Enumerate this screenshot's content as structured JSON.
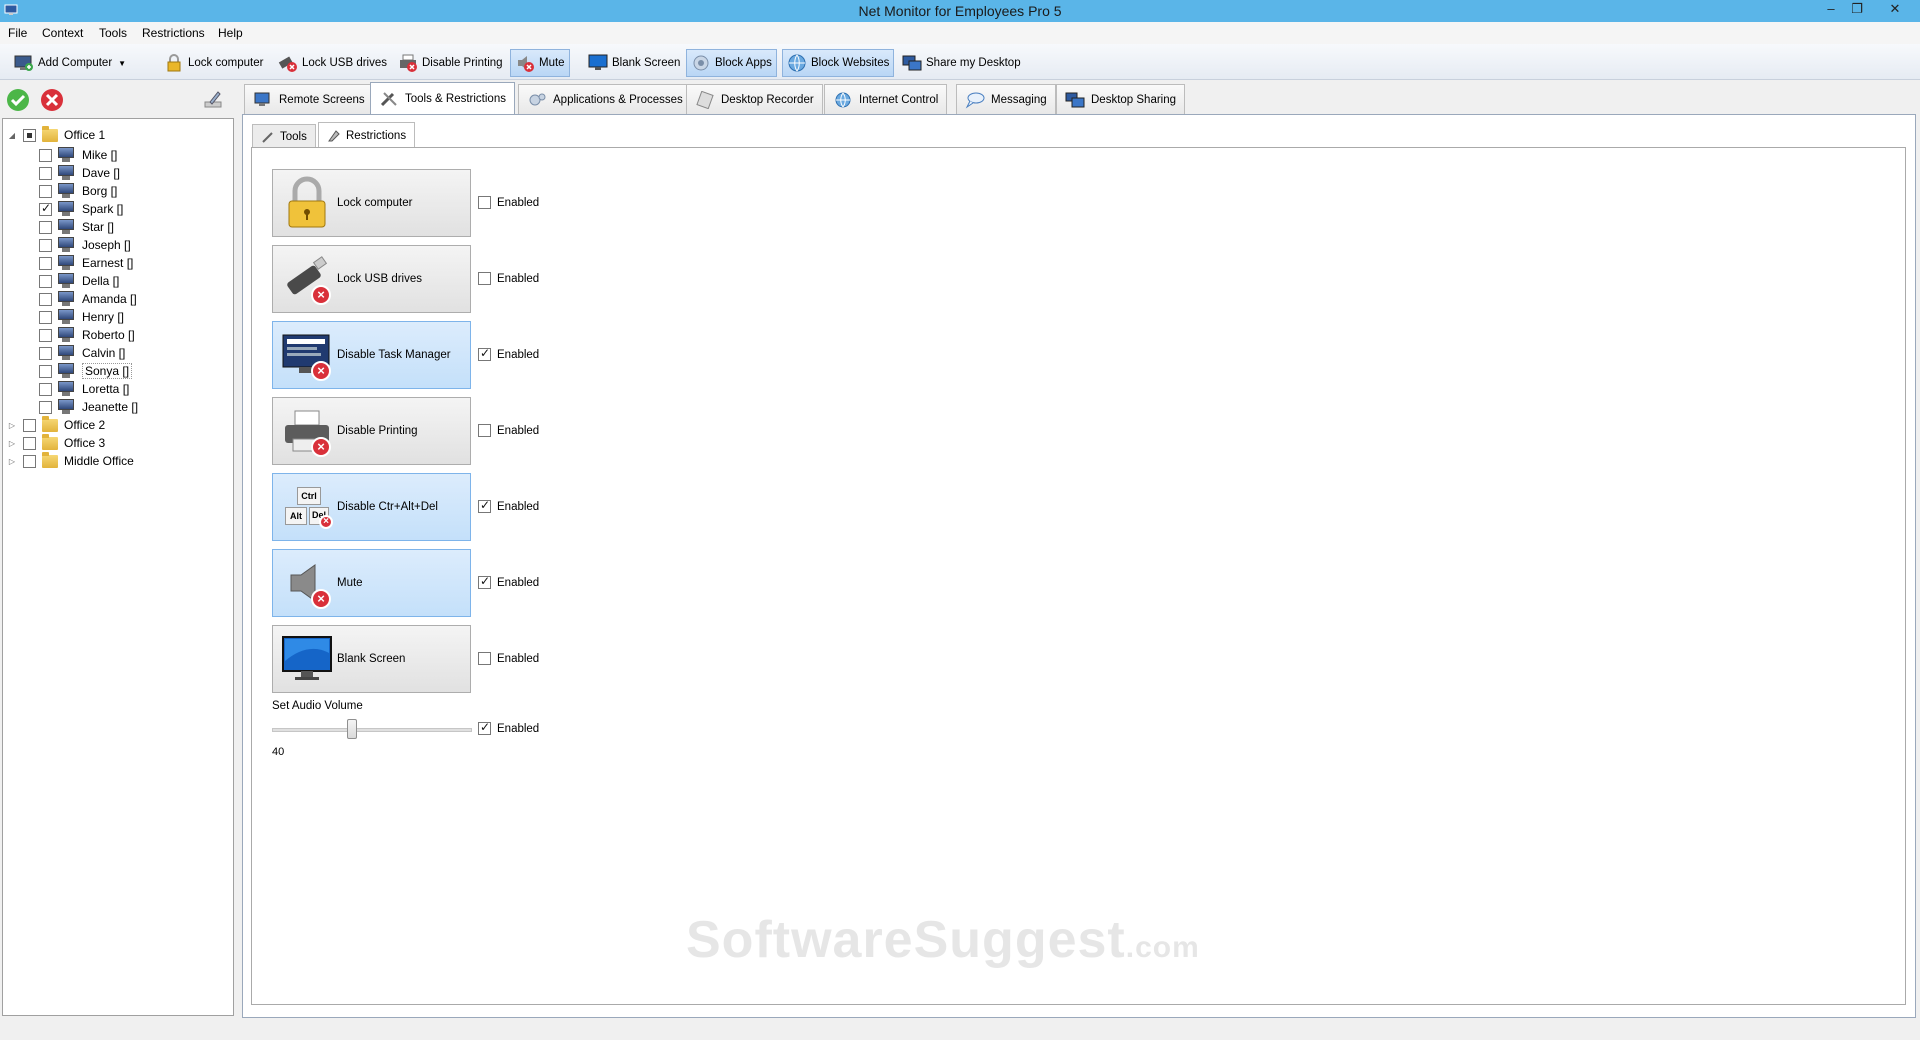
{
  "window": {
    "title": "Net Monitor for Employees Pro 5",
    "minimize": "–",
    "maximize": "❐",
    "close": "✕"
  },
  "menu": [
    "File",
    "Context",
    "Tools",
    "Restrictions",
    "Help"
  ],
  "toolbar": {
    "add_computer": "Add Computer",
    "lock_computer": "Lock computer",
    "lock_usb": "Lock USB drives",
    "disable_printing": "Disable Printing",
    "mute": "Mute",
    "blank_screen": "Blank Screen",
    "block_apps": "Block Apps",
    "block_websites": "Block Websites",
    "share_desktop": "Share my Desktop"
  },
  "tree": {
    "groups": [
      {
        "label": "Office 1",
        "expanded": true,
        "check": "partial"
      },
      {
        "label": "Office 2",
        "expanded": false,
        "check": "none"
      },
      {
        "label": "Office 3",
        "expanded": false,
        "check": "none"
      },
      {
        "label": "Middle Office",
        "expanded": false,
        "check": "none"
      }
    ],
    "computers": [
      {
        "label": "Mike []",
        "checked": false
      },
      {
        "label": "Dave []",
        "checked": false
      },
      {
        "label": "Borg []",
        "checked": false
      },
      {
        "label": "Spark []",
        "checked": true
      },
      {
        "label": "Star []",
        "checked": false
      },
      {
        "label": "Joseph []",
        "checked": false
      },
      {
        "label": "Earnest  []",
        "checked": false
      },
      {
        "label": "Della []",
        "checked": false
      },
      {
        "label": "Amanda  []",
        "checked": false
      },
      {
        "label": "Henry  []",
        "checked": false
      },
      {
        "label": "Roberto  []",
        "checked": false
      },
      {
        "label": "Calvin  []",
        "checked": false
      },
      {
        "label": "Sonya []",
        "checked": false
      },
      {
        "label": "Loretta  []",
        "checked": false
      },
      {
        "label": "Jeanette  []",
        "checked": false
      }
    ]
  },
  "tabs": [
    "Remote Screens",
    "Tools & Restrictions",
    "Applications & Processes",
    "Desktop Recorder",
    "Internet Control",
    "Messaging",
    "Desktop Sharing"
  ],
  "subtabs": [
    "Tools",
    "Restrictions"
  ],
  "restrictions": [
    {
      "label": "Lock computer",
      "enabled": false
    },
    {
      "label": "Lock USB drives",
      "enabled": false
    },
    {
      "label": "Disable Task Manager",
      "enabled": true
    },
    {
      "label": "Disable Printing",
      "enabled": false
    },
    {
      "label": "Disable Ctr+Alt+Del",
      "enabled": true
    },
    {
      "label": "Mute",
      "enabled": true
    },
    {
      "label": "Blank Screen",
      "enabled": false
    }
  ],
  "enabled_label": "Enabled",
  "audio": {
    "label": "Set Audio Volume",
    "value": "40",
    "enabled": true,
    "level_fraction": 0.4
  },
  "watermark": {
    "main": "SoftwareSuggest",
    "suffix": ".com"
  },
  "ctrl_keys": {
    "ctrl": "Ctrl",
    "alt": "Alt",
    "del": "Del"
  }
}
